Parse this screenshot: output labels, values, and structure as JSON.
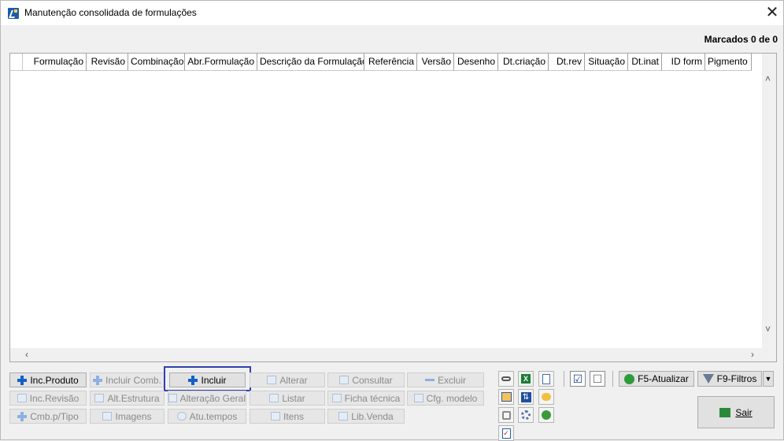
{
  "window": {
    "title": "Manutenção consolidada de formulações",
    "close_glyph": "✕"
  },
  "status": {
    "marcados": "Marcados 0 de 0"
  },
  "grid": {
    "columns": [
      "Formulação",
      "Revisão",
      "Combinação",
      "Abr.Formulação",
      "Descrição da Formulação",
      "Referência",
      "Versão",
      "Desenho",
      "Dt.criação",
      "Dt.rev",
      "Situação",
      "Dt.inat",
      "ID form",
      "Pigmento"
    ],
    "rows": []
  },
  "buttons": {
    "inc_produto": "Inc.Produto",
    "incluir_comb": "Incluir Comb.",
    "incluir": "Incluir",
    "alterar": "Alterar",
    "consultar": "Consultar",
    "excluir": "Excluir",
    "inc_revisao": "Inc.Revisão",
    "alt_estrutura": "Alt.Estrutura",
    "alteracao_geral": "Alteração Geral",
    "listar": "Listar",
    "ficha_tecnica": "Ficha técnica",
    "cfg_modelo": "Cfg. modelo",
    "cmb_tipo": "Cmb.p/Tipo",
    "imagens": "Imagens",
    "atu_tempos": "Atu.tempos",
    "itens": "Itens",
    "lib_venda": "Lib.Venda",
    "f5_atualizar": "F5-Atualizar",
    "f9_filtros": "F9-Filtros",
    "sair": "Sair"
  },
  "icons": {
    "toolbar": [
      "binoculars-icon",
      "excel-icon",
      "document-icon",
      "calendar-icon",
      "sort-icon",
      "palette-icon",
      "tools-icon",
      "gear-icon",
      "recycle-icon",
      "checklist-icon"
    ],
    "check_all": "☑",
    "uncheck_all": "☐"
  },
  "colors": {
    "highlight_border": "#3040b0",
    "accent_blue": "#1560c8"
  }
}
